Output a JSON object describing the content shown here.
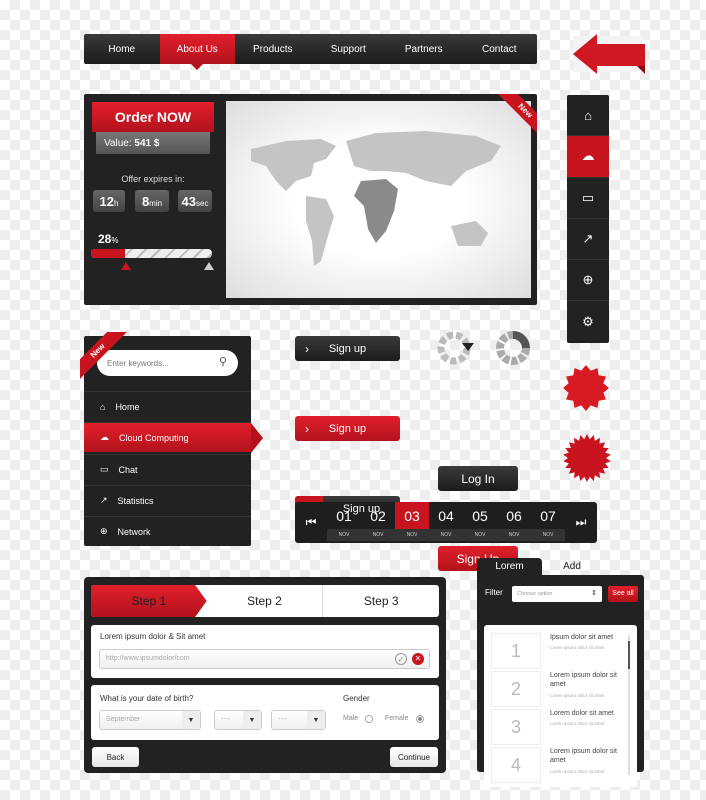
{
  "nav": {
    "items": [
      "Home",
      "About Us",
      "Products",
      "Support",
      "Partners",
      "Contact"
    ],
    "active": "About Us"
  },
  "hero": {
    "order_label": "Order NOW",
    "value_label": "Value:",
    "value": "541 $",
    "offer_label": "Offer expires in:",
    "timer": [
      {
        "v": "12",
        "u": "h"
      },
      {
        "v": "8",
        "u": "min"
      },
      {
        "v": "43",
        "u": "sec"
      }
    ],
    "progress_value": "28",
    "progress_unit": "%",
    "progress": 28,
    "ribbon": "New"
  },
  "vnav": {
    "icons": [
      "home-icon",
      "cloud-icon",
      "chat-icon",
      "statistics-icon",
      "globe-icon",
      "gear-icon"
    ],
    "active": 1
  },
  "sidebar": {
    "ribbon": "New",
    "search_placeholder": "Enter keywords...",
    "items": [
      {
        "label": "Home",
        "icon": "home-icon"
      },
      {
        "label": "Cloud Computing",
        "icon": "cloud-icon"
      },
      {
        "label": "Chat",
        "icon": "chat-icon"
      },
      {
        "label": "Statistics",
        "icon": "statistics-icon"
      },
      {
        "label": "Network",
        "icon": "globe-icon"
      }
    ],
    "active": 1
  },
  "buttons": {
    "signup1": "Sign up",
    "signup2": "Sign up",
    "signup3": "Sign up",
    "login": "Log In",
    "signup4": "Sign Up"
  },
  "pager": {
    "days": [
      "01",
      "02",
      "03",
      "04",
      "05",
      "06",
      "07"
    ],
    "month": "NOV",
    "active": "03"
  },
  "wizard": {
    "steps": [
      "Step 1",
      "Step 2",
      "Step 3"
    ],
    "active_step": 1,
    "field_label": "Lorem ipsum dolor & Sit amet",
    "url_value": "http://www.ipsumdolor/com",
    "dob_label": "What is your date of birth?",
    "month_value": "September",
    "day_value": "----",
    "year_value": "----",
    "gender_label": "Gender",
    "male": "Male",
    "female": "Female",
    "gender_selected": "Female",
    "back": "Back",
    "continue": "Continue"
  },
  "tabs": {
    "items": [
      "Lorem",
      "Add"
    ],
    "active": "Lorem",
    "filter_label": "Filter",
    "filter_placeholder": "Choose option",
    "see_all": "See all",
    "list": [
      {
        "n": "1",
        "title": "Ipsum dolor sit amet",
        "sub": "Lorem ipsum dolor sit amet"
      },
      {
        "n": "2",
        "title": "Lorem ipsum dolor sit amet",
        "sub": "Lorem ipsum dolor sit amet"
      },
      {
        "n": "3",
        "title": "Lorem dolor sit amet",
        "sub": "Lorem ipsum dolor sit amet"
      },
      {
        "n": "4",
        "title": "Lorem ipsum dolor sit amet",
        "sub": "Lorem ipsum dolor sit amet"
      }
    ]
  },
  "colors": {
    "accent": "#c8141e",
    "dark": "#222222"
  }
}
